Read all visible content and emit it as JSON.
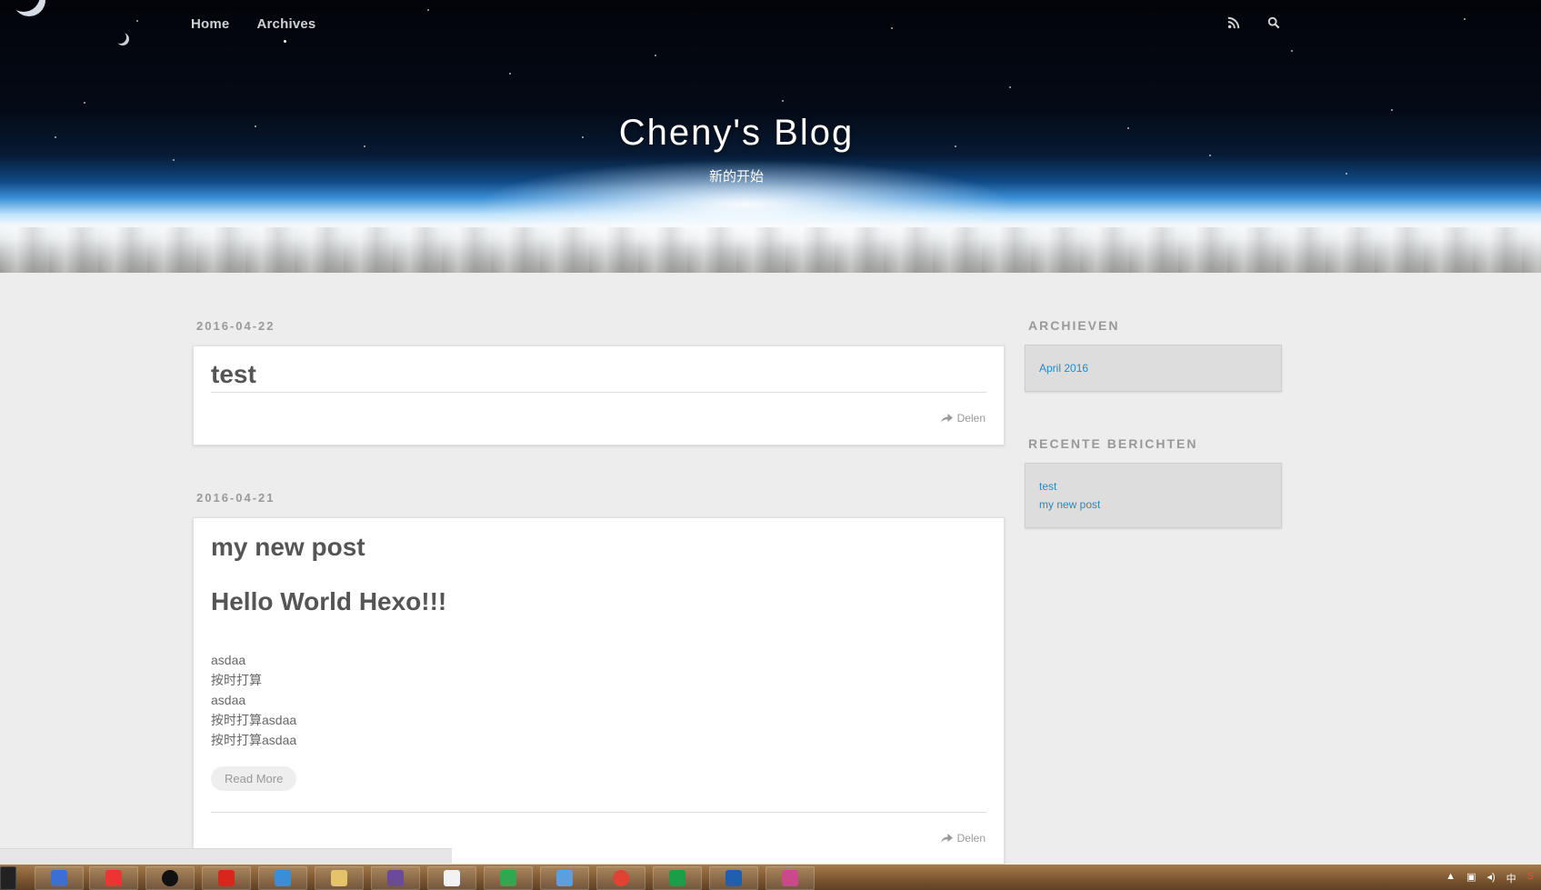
{
  "nav": {
    "items": [
      {
        "label": "Home"
      },
      {
        "label": "Archives"
      }
    ],
    "icons": [
      "rss-icon",
      "search-icon"
    ]
  },
  "header": {
    "title": "Cheny's Blog",
    "subtitle": "新的开始"
  },
  "posts": [
    {
      "date": "2016-04-22",
      "title": "test",
      "share_label": "Delen"
    },
    {
      "date": "2016-04-21",
      "title": "my new post",
      "heading": "Hello World Hexo!!!",
      "lines": [
        "asdaa",
        "按时打算",
        "asdaa",
        "按时打算asdaa",
        "按时打算asdaa"
      ],
      "read_more": "Read More",
      "share_label": "Delen"
    }
  ],
  "sidebar": {
    "archives_heading": "ARCHIEVEN",
    "archives": [
      "April 2016"
    ],
    "recent_heading": "RECENTE BERICHTEN",
    "recent": [
      "test",
      "my new post"
    ]
  },
  "taskbar": {
    "tray_lang": "中"
  },
  "colors": {
    "link": "#2a88c4",
    "background": "#ededed"
  }
}
